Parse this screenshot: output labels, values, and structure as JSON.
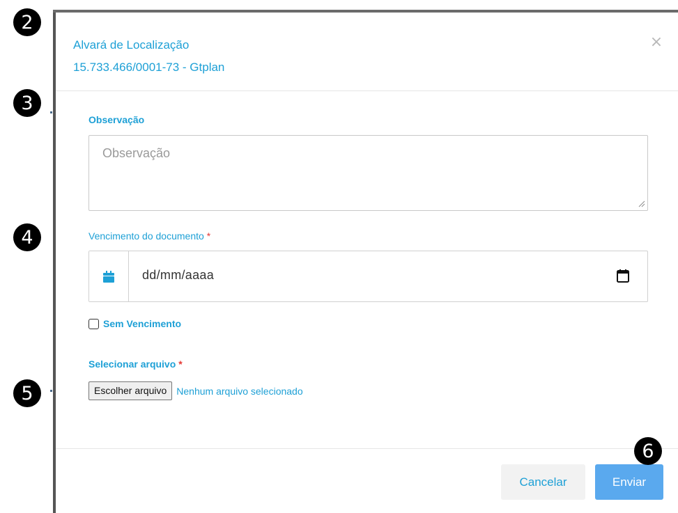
{
  "markers": [
    "2",
    "3",
    "4",
    "5",
    "6"
  ],
  "modal": {
    "title": "Alvará de Localização",
    "subtitle": "15.733.466/0001-73 - Gtplan",
    "close_label": "×"
  },
  "observacao": {
    "label": "Observação",
    "placeholder": "Observação"
  },
  "vencimento": {
    "label": "Vencimento do documento",
    "required_mark": "*",
    "date_placeholder": "dd/mm/aaaa"
  },
  "sem_vencimento": {
    "label": "Sem Vencimento",
    "checked": false
  },
  "arquivo": {
    "label": "Selecionar arquivo",
    "required_mark": "*",
    "button_label": "Escolher arquivo",
    "status": "Nenhum arquivo selecionado"
  },
  "footer": {
    "cancel_label": "Cancelar",
    "submit_label": "Enviar"
  },
  "colors": {
    "accent": "#1ea0d6",
    "primary_button": "#5aa9ee",
    "required": "#e53935"
  },
  "icons": {
    "date_addon": "calendar-icon",
    "date_picker": "calendar-picker-icon",
    "close": "close-icon"
  }
}
